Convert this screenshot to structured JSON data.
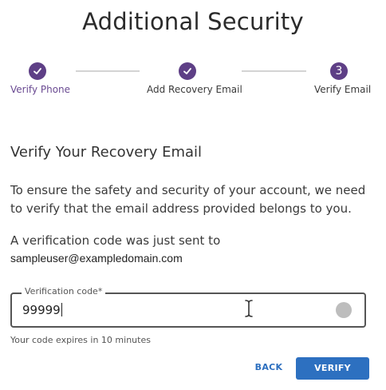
{
  "page": {
    "title": "Additional Security"
  },
  "stepper": {
    "steps": [
      {
        "label": "Verify Phone",
        "state": "completed",
        "icon": "check-icon"
      },
      {
        "label": "Add Recovery Email",
        "state": "completed",
        "icon": "check-icon"
      },
      {
        "label": "Verify Email",
        "state": "current",
        "number": "3"
      }
    ],
    "accent_color": "#5e3f86"
  },
  "content": {
    "heading": "Verify Your Recovery Email",
    "intro_line1": "To ensure the safety and security of your account, we need",
    "intro_line2": "to verify that the email address provided belongs to you.",
    "code_sent_text": "A verification code was just sent to",
    "email": "sampleuser@exampledomain.com"
  },
  "form": {
    "code_label": "Verification code*",
    "code_value": "99999",
    "hint": "Your code expires in 10 minutes"
  },
  "actions": {
    "back_label": "BACK",
    "verify_label": "VERIFY",
    "primary_color": "#2d70c0"
  }
}
